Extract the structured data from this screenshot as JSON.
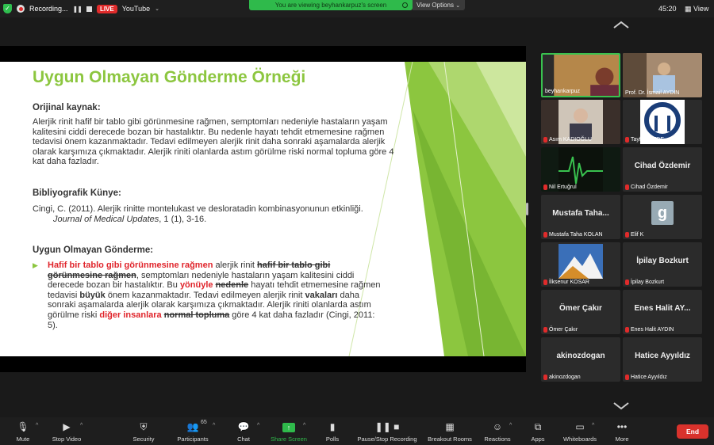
{
  "topbar": {
    "recording_label": "Recording...",
    "live_label": "LIVE",
    "stream_target": "YouTube",
    "share_banner": "You are viewing beyhankarpuz's screen",
    "view_options": "View Options",
    "timer": "45:20",
    "view_label": "View"
  },
  "slide": {
    "title": "Uygun Olmayan Gönderme Örneği",
    "section1_heading": "Orijinal kaynak:",
    "section1_text": "Alerjik rinit hafif bir tablo gibi görünmesine rağmen, semptomları nedeniyle hastaların yaşam kalitesini ciddi derecede bozan bir hastalıktır. Bu nedenle hayatı tehdit etmemesine rağmen tedavisi önem kazanmaktadır. Tedavi edilmeyen alerjik rinit daha sonraki aşamalarda alerjik olarak karşımıza çıkmaktadır. Alerjik riniti olanlarda astım görülme riski normal topluma göre 4 kat daha fazladır.",
    "section2_heading": "Bibliyografik Künye:",
    "bib_prefix": "Cingi, C. (2011). Alerjik rinitte montelukast ve desloratadin kombinasyonunun etkinliği. ",
    "bib_journal": "Journal of Medical Updates",
    "bib_suffix": ", 1 (1), 3-16.",
    "section3_heading": "Uygun Olmayan Gönderme:",
    "b_red1": "Hafif bir tablo gibi görünmesine rağmen",
    "b_t1": " alerjik rinit ",
    "b_strike1": "hafif bir tablo gibi görünmesine rağmen",
    "b_t2": ", semptomları nedeniyle hastaların yaşam kalitesini ciddi derecede bozan bir hastalıktır. Bu ",
    "b_red2": "yönüyle",
    "b_t3": " ",
    "b_strike2": "nedenle",
    "b_t4": " hayatı tehdit etmemesine rağmen tedavisi ",
    "b_bold1": "büyük",
    "b_t5": " önem kazanmaktadır. Tedavi edilmeyen alerjik rinit ",
    "b_bold2": "vakaları",
    "b_t6": " daha sonraki aşamalarda alerjik olarak karşımıza çıkmaktadır. Alerjik riniti olanlarda astım görülme riski ",
    "b_red3": "diğer insanlara",
    "b_t7": " ",
    "b_strike3": "normal topluma",
    "b_t8": " göre 4 kat daha fazladır (Cingi, 2011: 5)."
  },
  "gallery": {
    "participants": [
      {
        "name": "beyhankarpuz"
      },
      {
        "name": "Prof. Dr. İsmail AYDIN"
      },
      {
        "name": "Asım KADIOĞLU"
      },
      {
        "name": "Tayfun DEDE"
      },
      {
        "name": "Nil Ertuğrul"
      },
      {
        "name": "Cihad Özdemir",
        "label": "Cihad Özdemir"
      },
      {
        "name": "Mustafa Taha KOLAN",
        "label": "Mustafa Taha..."
      },
      {
        "name": "Elif K",
        "label": "g"
      },
      {
        "name": "İlksenur KOSAR"
      },
      {
        "name": "İpilay Bozkurt",
        "label": "İpilay Bozkurt"
      },
      {
        "name": "Ömer Çakır",
        "label": "Ömer Çakır"
      },
      {
        "name": "Enes Halit AYDIN",
        "label": "Enes Halit AY..."
      },
      {
        "name": "akinozdogan",
        "label": "akinozdogan"
      },
      {
        "name": "Hatice Ayyıldız",
        "label": "Hatice Ayyıldız"
      }
    ]
  },
  "toolbar": {
    "mute": "Mute",
    "stop_video": "Stop Video",
    "security": "Security",
    "participants": "Participants",
    "participants_count": "65",
    "chat": "Chat",
    "share_screen": "Share Screen",
    "polls": "Polls",
    "pause_recording": "Pause/Stop Recording",
    "breakout": "Breakout Rooms",
    "reactions": "Reactions",
    "apps": "Apps",
    "whiteboards": "Whiteboards",
    "more": "More",
    "end": "End"
  },
  "colors": {
    "accent_green": "#2fba4b",
    "slide_title_green": "#8cc63f",
    "red_highlight": "#e0242b",
    "end_red": "#d9322c"
  }
}
